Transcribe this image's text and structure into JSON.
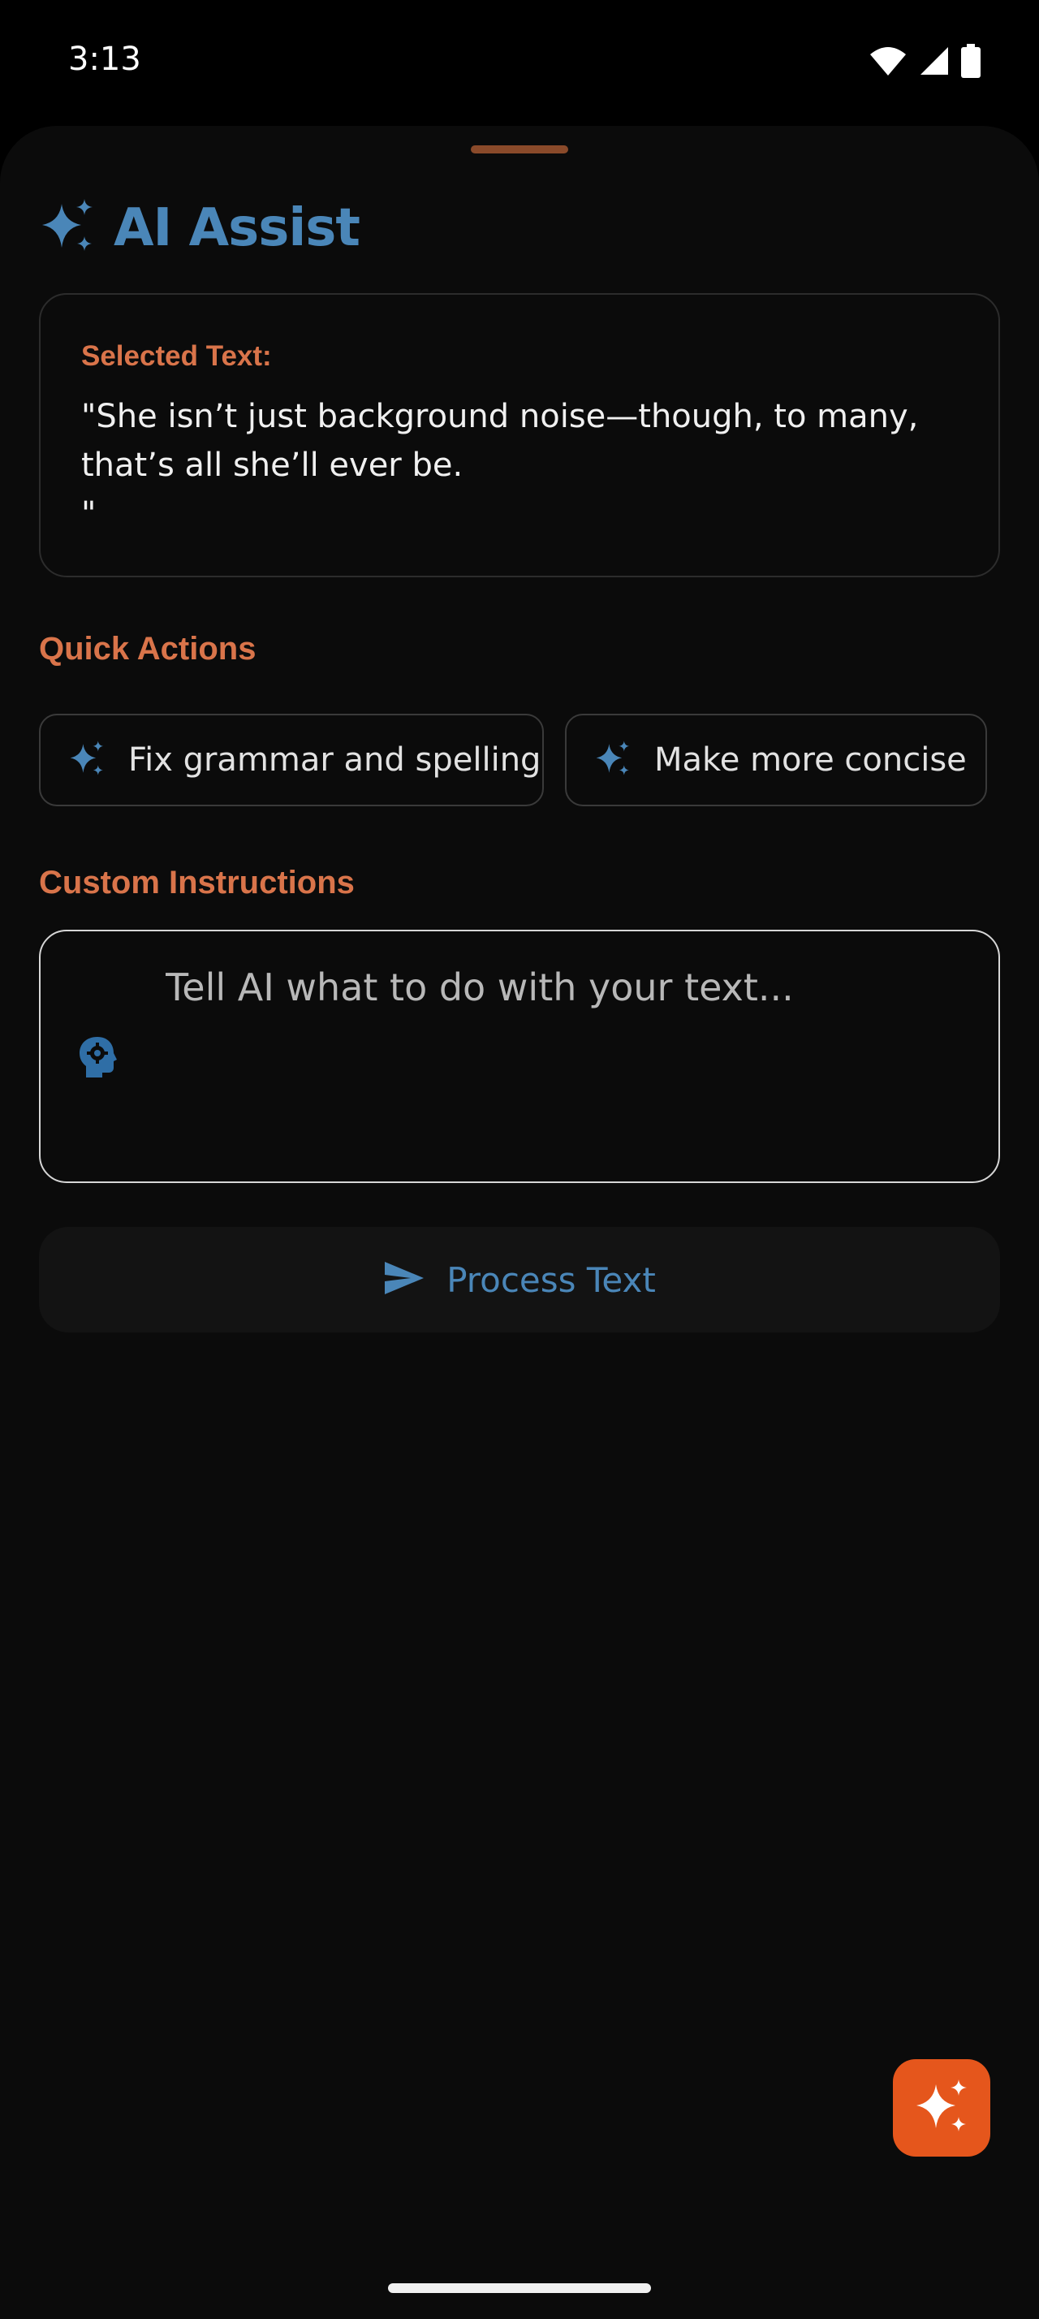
{
  "status_bar": {
    "time": "3:13",
    "icons": [
      "wifi-icon",
      "signal-icon",
      "battery-icon"
    ]
  },
  "header": {
    "title": "AI Assist",
    "icon": "sparkles-icon"
  },
  "selected_text": {
    "label": "Selected Text:",
    "body": "\"She isn’t just background noise—though, to many, that’s all she’ll ever be.\n\""
  },
  "quick_actions": {
    "title": "Quick Actions",
    "items": [
      {
        "label": "Fix grammar and spelling",
        "icon": "sparkles-icon"
      },
      {
        "label": "Make more concise",
        "icon": "sparkles-icon"
      }
    ]
  },
  "custom_instructions": {
    "title": "Custom Instructions",
    "placeholder": "Tell AI what to do with your text...",
    "value": "",
    "icon": "brain-gear-icon"
  },
  "process_button": {
    "label": "Process Text",
    "icon": "send-icon"
  },
  "fab": {
    "icon": "sparkles-icon"
  },
  "colors": {
    "accent_blue": "#4a86b8",
    "accent_orange": "#d9744a",
    "fab_orange": "#e5561c",
    "background": "#0b0b0b"
  }
}
